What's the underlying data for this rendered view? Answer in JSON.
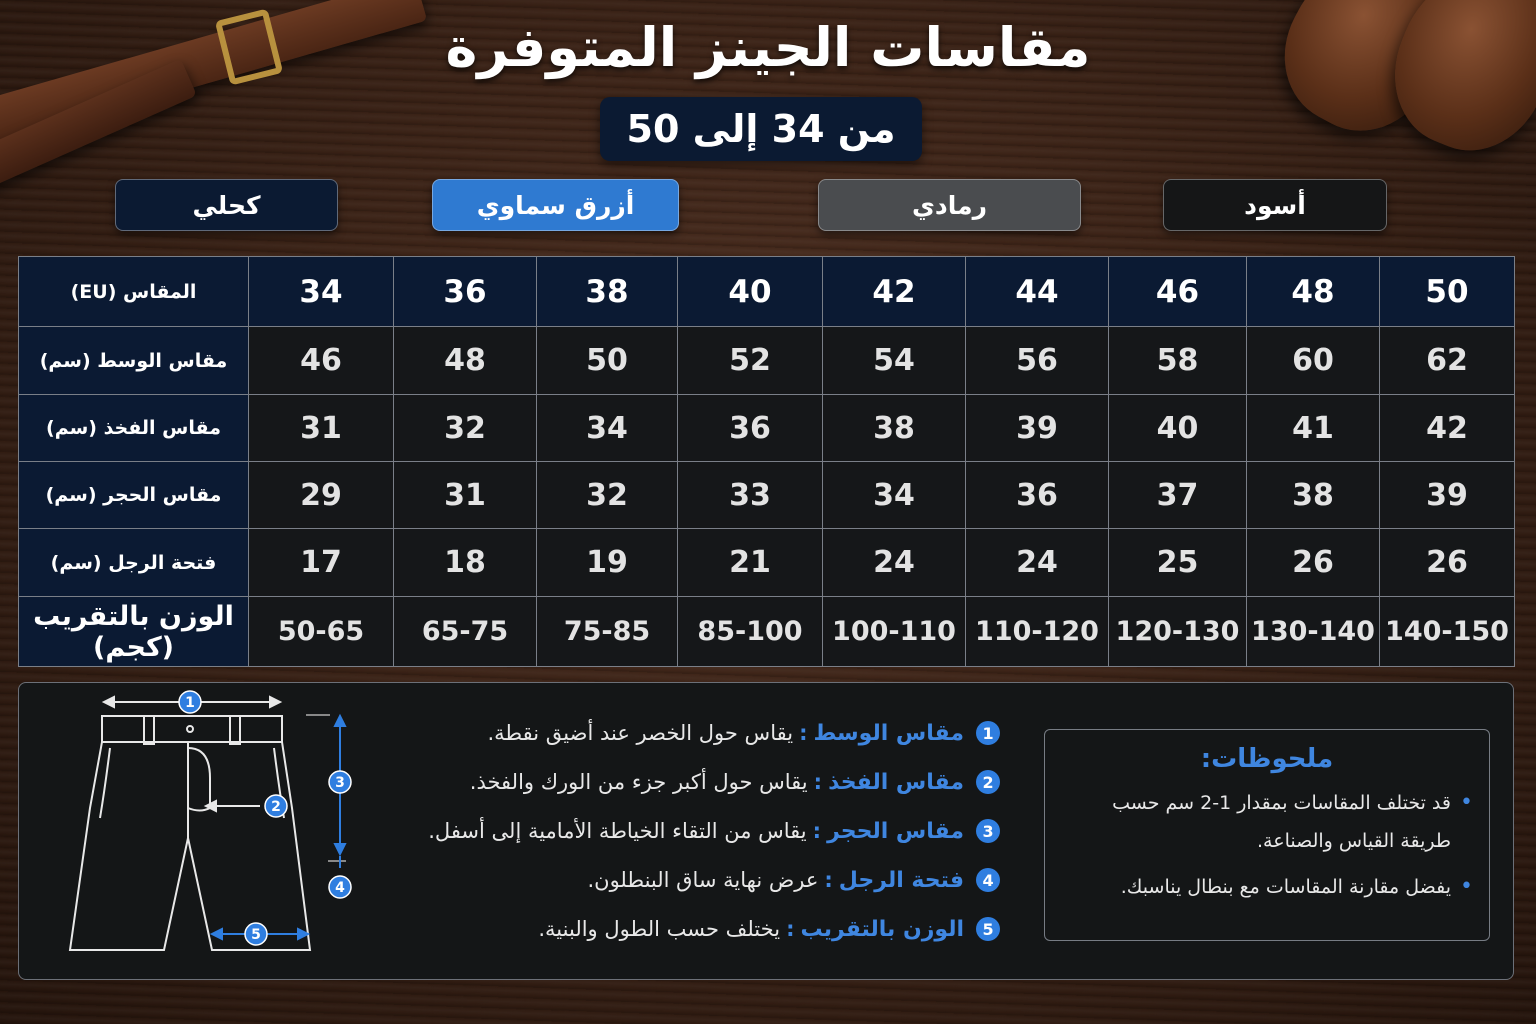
{
  "title": "مقاسات الجينز المتوفرة",
  "size_range": "من 34 إلى 50",
  "colors": [
    {
      "label": "كحلي",
      "bg": "#0b1a32"
    },
    {
      "label": "أزرق سماوي",
      "bg": "#2f7ad1"
    },
    {
      "label": "رمادي",
      "bg": "#4a4c4f"
    },
    {
      "label": "أسود",
      "bg": "#151617"
    }
  ],
  "table": {
    "rows": [
      {
        "label": "المقاس (EU)",
        "values": [
          "34",
          "36",
          "38",
          "40",
          "42",
          "44",
          "46",
          "48",
          "50"
        ]
      },
      {
        "label": "مقاس الوسط (سم)",
        "values": [
          "46",
          "48",
          "50",
          "52",
          "54",
          "56",
          "58",
          "60",
          "62"
        ]
      },
      {
        "label": "مقاس الفخذ (سم)",
        "values": [
          "31",
          "32",
          "34",
          "36",
          "38",
          "39",
          "40",
          "41",
          "42"
        ]
      },
      {
        "label": "مقاس الحجر (سم)",
        "values": [
          "29",
          "31",
          "32",
          "33",
          "34",
          "36",
          "37",
          "38",
          "39"
        ]
      },
      {
        "label": "فتحة الرجل (سم)",
        "values": [
          "17",
          "18",
          "19",
          "21",
          "24",
          "24",
          "25",
          "26",
          "26"
        ]
      },
      {
        "label": "الوزن بالتقريب (كجم)",
        "values": [
          "50-65",
          "65-75",
          "75-85",
          "85-100",
          "100-110",
          "110-120",
          "120-130",
          "130-140",
          "140-150"
        ]
      }
    ]
  },
  "legend": [
    {
      "num": "1",
      "term": "مقاس الوسط",
      "desc": "يقاس حول الخصر عند أضيق نقطة."
    },
    {
      "num": "2",
      "term": "مقاس الفخذ",
      "desc": "يقاس حول أكبر جزء من الورك والفخذ."
    },
    {
      "num": "3",
      "term": "مقاس الحجر",
      "desc": "يقاس من التقاء الخياطة الأمامية إلى أسفل."
    },
    {
      "num": "4",
      "term": "فتحة الرجل",
      "desc": "عرض نهاية ساق البنطلون."
    },
    {
      "num": "5",
      "term": "الوزن بالتقريب",
      "desc": "يختلف حسب الطول والبنية."
    }
  ],
  "notes": {
    "title": "ملحوظات:",
    "items": [
      "قد تختلف المقاسات بمقدار 1-2 سم حسب طريقة القياس والصناعة.",
      "يفضل مقارنة المقاسات مع بنطال يناسبك."
    ]
  },
  "diagram_markers": [
    "1",
    "2",
    "3",
    "4",
    "5"
  ],
  "accent_color": "#2f7ee0"
}
